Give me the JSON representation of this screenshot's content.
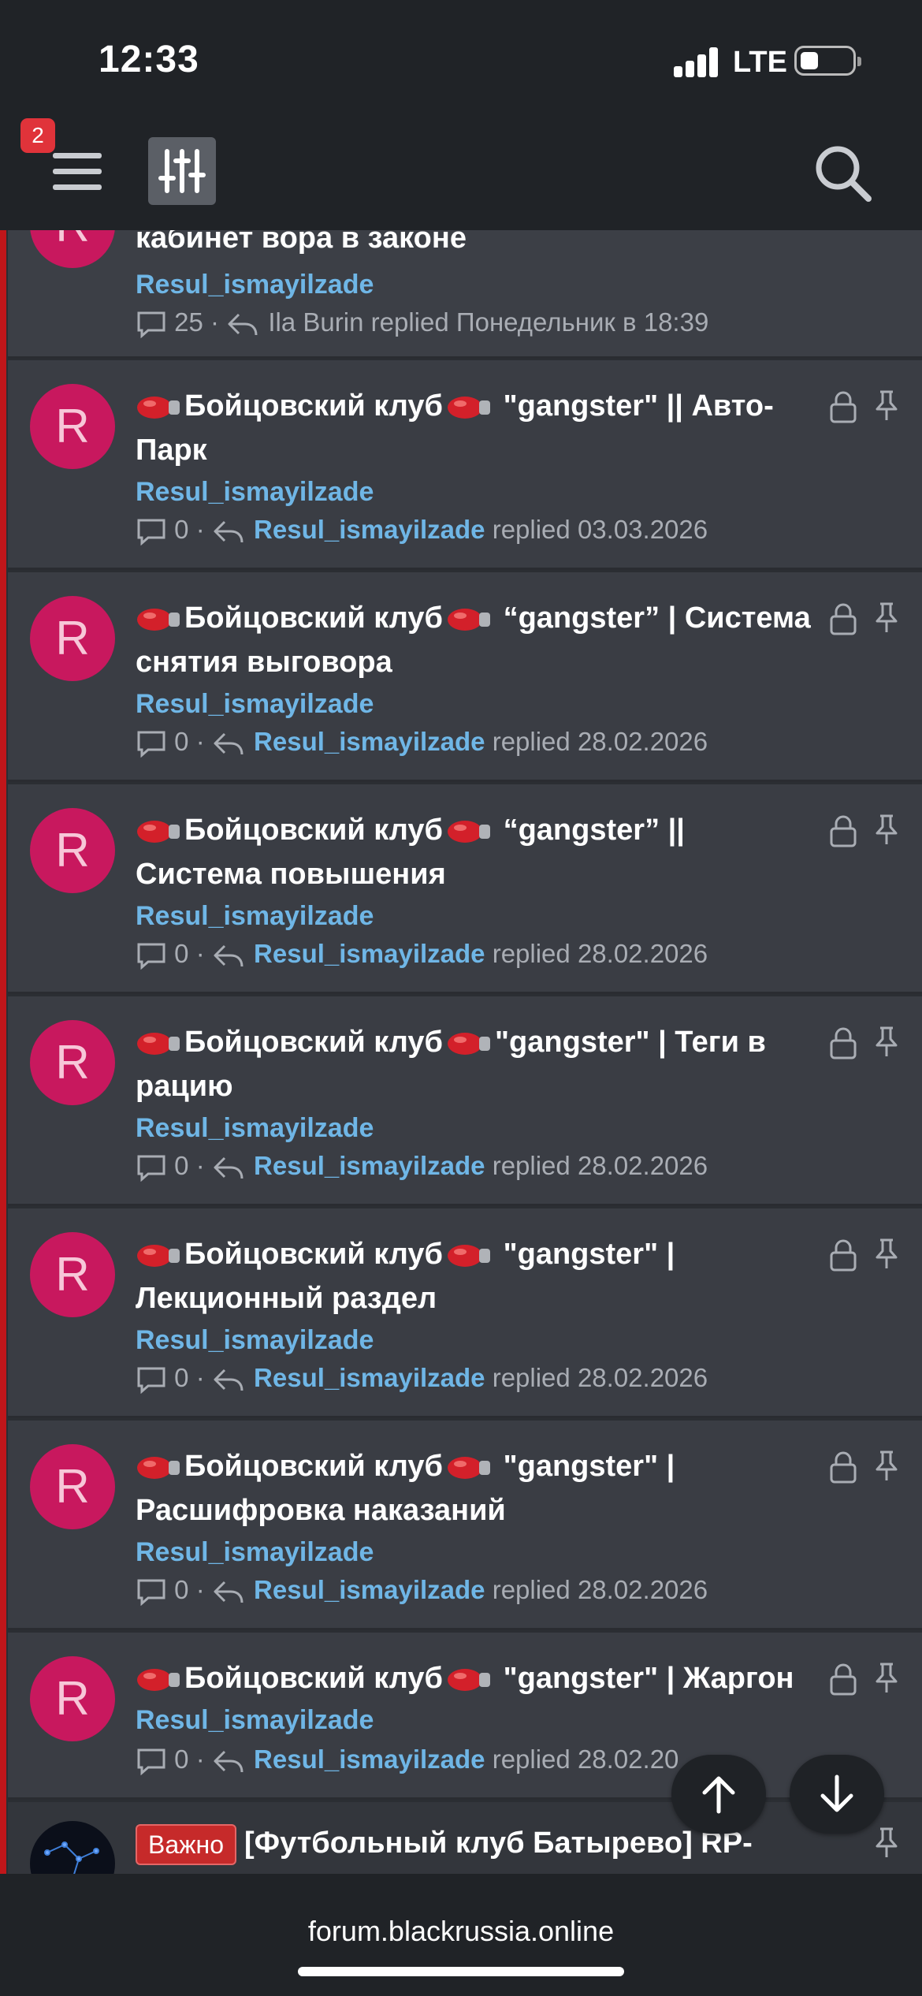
{
  "status": {
    "time": "12:33",
    "network": "LTE"
  },
  "header": {
    "notification_count": "2"
  },
  "threads": [
    {
      "avatar_letter": "R",
      "title": "кабинет вора в законе",
      "author": "Resul_ismayilzade",
      "replies": "25",
      "last_user": "Ila Burin",
      "replied_word": "replied",
      "date": "Понедельник в 18:39"
    },
    {
      "avatar_letter": "R",
      "title_prefix": "Бойцовский клуб",
      "title_rest": " \"gangster\" || Авто-Парк",
      "author": "Resul_ismayilzade",
      "replies": "0",
      "last_user": "Resul_ismayilzade",
      "replied_word": "replied",
      "date": "03.03.2026"
    },
    {
      "avatar_letter": "R",
      "title_prefix": "Бойцовский клуб",
      "title_rest": " “gangster” | Система снятия выговора",
      "author": "Resul_ismayilzade",
      "replies": "0",
      "last_user": "Resul_ismayilzade",
      "replied_word": "replied",
      "date": "28.02.2026"
    },
    {
      "avatar_letter": "R",
      "title_prefix": "Бойцовский клуб",
      "title_rest": " “gangster” || Система повышения",
      "author": "Resul_ismayilzade",
      "replies": "0",
      "last_user": "Resul_ismayilzade",
      "replied_word": "replied",
      "date": "28.02.2026"
    },
    {
      "avatar_letter": "R",
      "title_prefix": "Бойцовский клуб",
      "title_rest": "\"gangster\" | Теги в рацию",
      "author": "Resul_ismayilzade",
      "replies": "0",
      "last_user": "Resul_ismayilzade",
      "replied_word": "replied",
      "date": "28.02.2026"
    },
    {
      "avatar_letter": "R",
      "title_prefix": "Бойцовский клуб",
      "title_rest": " \"gangster\" | Лекционный раздел",
      "author": "Resul_ismayilzade",
      "replies": "0",
      "last_user": "Resul_ismayilzade",
      "replied_word": "replied",
      "date": "28.02.2026"
    },
    {
      "avatar_letter": "R",
      "title_prefix": "Бойцовский клуб",
      "title_rest": " \"gangster\" | Расшифровка наказаний",
      "author": "Resul_ismayilzade",
      "replies": "0",
      "last_user": "Resul_ismayilzade",
      "replied_word": "replied",
      "date": "28.02.2026"
    },
    {
      "avatar_letter": "R",
      "title_prefix": "Бойцовский клуб",
      "title_rest": " \"gangster\" | Жаргон",
      "author": "Resul_ismayilzade",
      "replies": "0",
      "last_user": "Resul_ismayilzade",
      "replied_word": "replied",
      "date": "28.02.20"
    },
    {
      "label": "Важно",
      "title": "[Футбольный клуб Батырево] RP-"
    }
  ],
  "browser": {
    "url": "forum.blackrussia.online"
  },
  "colors": {
    "accent_link": "#6fb6e6",
    "avatar": "#c8185e",
    "sticky_bar": "#c0161a",
    "important_label": "#c62a2a"
  }
}
